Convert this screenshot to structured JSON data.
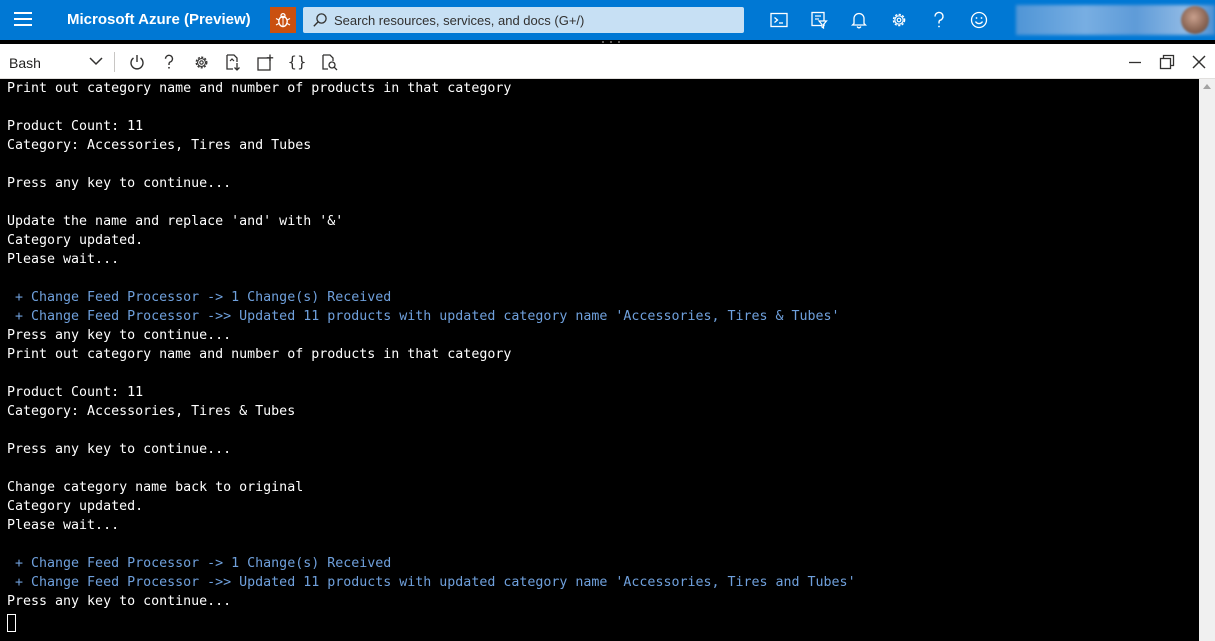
{
  "topbar": {
    "brand": "Microsoft Azure (Preview)",
    "search_placeholder": "Search resources, services, and docs (G+/)",
    "color": "#0078d4",
    "icons": [
      "menu-icon",
      "bug-icon",
      "search-icon",
      "cloud-shell-icon",
      "directory-filter-icon",
      "bell-icon",
      "gear-icon",
      "help-icon",
      "feedback-smiley-icon"
    ]
  },
  "shell": {
    "selected": "Bash",
    "toolbar_icons": [
      "power-icon",
      "help-icon",
      "gear-icon",
      "upload-download-icon",
      "open-session-icon",
      "braces-icon",
      "web-preview-icon"
    ],
    "window_icons": [
      "minimize-icon",
      "restore-icon",
      "close-icon"
    ]
  },
  "terminal": {
    "lines": [
      {
        "text": "Print out category name and number of products in that category",
        "style": "normal"
      },
      {
        "text": "",
        "style": "normal"
      },
      {
        "text": "Product Count: 11",
        "style": "normal"
      },
      {
        "text": "Category: Accessories, Tires and Tubes",
        "style": "normal"
      },
      {
        "text": "",
        "style": "normal"
      },
      {
        "text": "Press any key to continue...",
        "style": "normal"
      },
      {
        "text": "",
        "style": "normal"
      },
      {
        "text": "Update the name and replace 'and' with '&'",
        "style": "normal"
      },
      {
        "text": "Category updated.",
        "style": "normal"
      },
      {
        "text": "Please wait...",
        "style": "normal"
      },
      {
        "text": "",
        "style": "normal"
      },
      {
        "text": " + Change Feed Processor -> 1 Change(s) Received",
        "style": "blue"
      },
      {
        "text": " + Change Feed Processor ->> Updated 11 products with updated category name 'Accessories, Tires & Tubes'",
        "style": "blue"
      },
      {
        "text": "Press any key to continue...",
        "style": "normal"
      },
      {
        "text": "Print out category name and number of products in that category",
        "style": "normal"
      },
      {
        "text": "",
        "style": "normal"
      },
      {
        "text": "Product Count: 11",
        "style": "normal"
      },
      {
        "text": "Category: Accessories, Tires & Tubes",
        "style": "normal"
      },
      {
        "text": "",
        "style": "normal"
      },
      {
        "text": "Press any key to continue...",
        "style": "normal"
      },
      {
        "text": "",
        "style": "normal"
      },
      {
        "text": "Change category name back to original",
        "style": "normal"
      },
      {
        "text": "Category updated.",
        "style": "normal"
      },
      {
        "text": "Please wait...",
        "style": "normal"
      },
      {
        "text": "",
        "style": "normal"
      },
      {
        "text": " + Change Feed Processor -> 1 Change(s) Received",
        "style": "blue"
      },
      {
        "text": " + Change Feed Processor ->> Updated 11 products with updated category name 'Accessories, Tires and Tubes'",
        "style": "blue"
      },
      {
        "text": "Press any key to continue...",
        "style": "normal"
      }
    ],
    "text_color": "#ffffff",
    "highlight_color": "#6fa0dc"
  }
}
